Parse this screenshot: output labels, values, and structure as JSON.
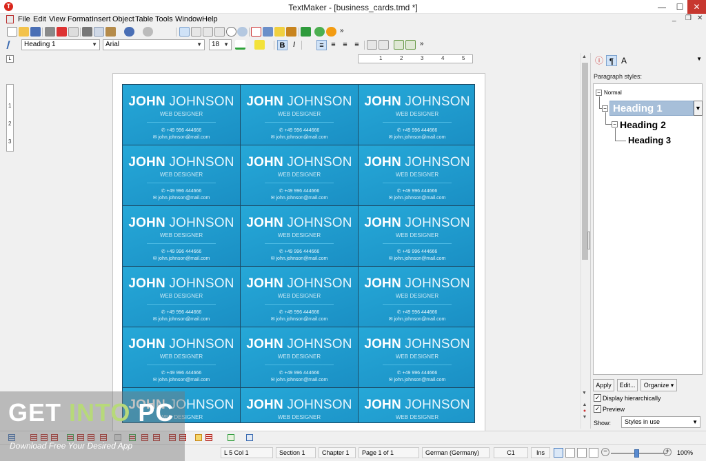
{
  "window": {
    "title": "TextMaker - [business_cards.tmd *]",
    "app_icon_glyph": "T",
    "minimize": "—",
    "maximize": "☐",
    "close": "✕"
  },
  "menu": {
    "items": [
      "File",
      "Edit",
      "View",
      "Format",
      "Insert",
      "Object",
      "Table",
      "Tools",
      "Window",
      "Help"
    ],
    "mdi_controls": [
      "_",
      "❐",
      "✕"
    ]
  },
  "toolbar_overflow": "»",
  "format_toolbar": {
    "paragraph_style": "Heading 1",
    "font": "Arial",
    "font_size": "18",
    "bold": "B",
    "italic": "I",
    "align_left": "≡",
    "align_center": "≡",
    "align_right": "≡",
    "justify": "≡"
  },
  "ruler": {
    "h_labels": [
      "1",
      "2",
      "3",
      "4",
      "5"
    ],
    "v_labels": [
      "1",
      "2",
      "3"
    ],
    "corner": "L"
  },
  "cards": {
    "first_name": "JOHN",
    "last_name": "JOHNSON",
    "role": "WEB DESIGNER",
    "phone": "✆ +49 996 444666",
    "email": "✉ john.johnson@mail.com",
    "count": 18
  },
  "side_panel": {
    "heading": "Paragraph styles:",
    "tree": {
      "normal": "Normal",
      "h1": "Heading 1",
      "h2": "Heading 2",
      "h3": "Heading 3"
    },
    "buttons": {
      "apply": "Apply",
      "edit": "Edit...",
      "organize": "Organize ▾"
    },
    "display_hierarchically": {
      "label": "Display hierarchically",
      "checked": true
    },
    "preview": {
      "label": "Preview",
      "checked": true
    },
    "show_label": "Show:",
    "show_value": "Styles in use"
  },
  "status_bar": {
    "position": "L 5 Col 1",
    "section": "Section 1",
    "chapter": "Chapter 1",
    "page": "Page 1 of 1",
    "language": "German (Germany)",
    "cell": "C1",
    "mode": "Ins",
    "zoom": "100%",
    "zoom_out": "−",
    "zoom_in": "+"
  },
  "watermark": {
    "get": "GET ",
    "into": "INTO",
    "pc": " PC",
    "tagline": "Download Free Your Desired App"
  },
  "colors": {
    "card_blue": "#1f9fd1",
    "accent_red": "#c7372f",
    "selected_style": "#a7bfd9"
  }
}
